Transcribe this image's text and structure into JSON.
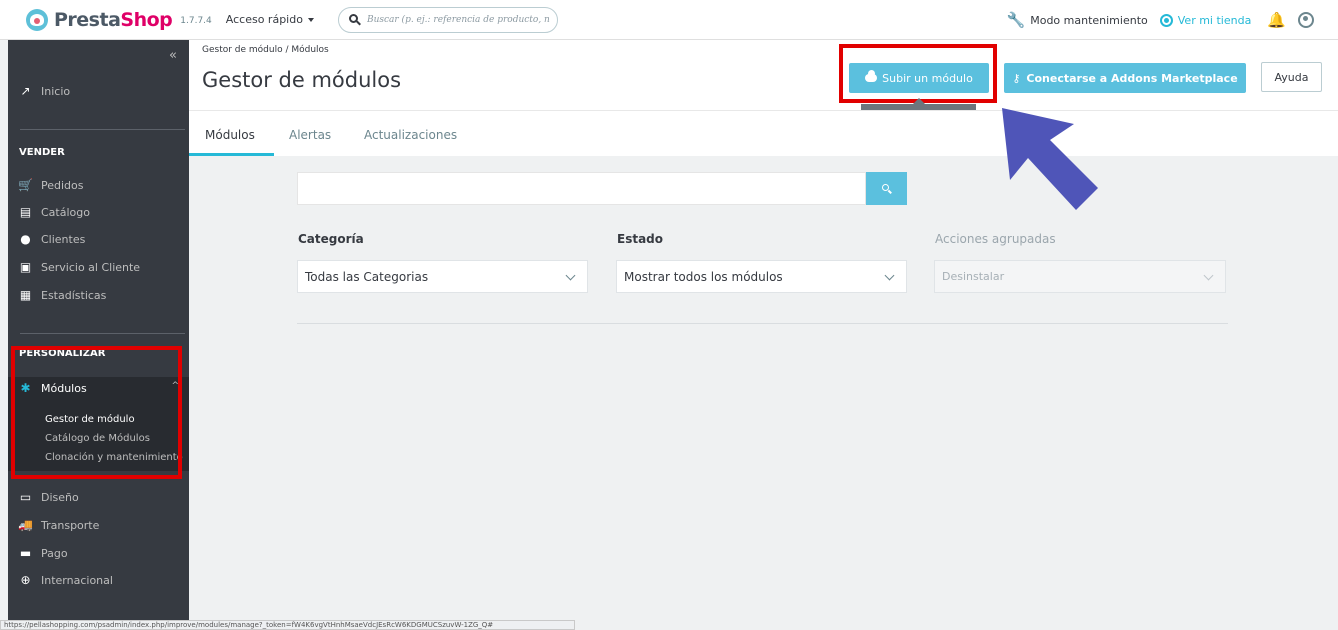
{
  "header": {
    "logo_text_presta": "Presta",
    "logo_text_shop": "Shop",
    "version": "1.7.7.4",
    "quick_access": "Acceso rápido",
    "search_placeholder": "Buscar (p. ej.: referencia de producto, n",
    "maintenance": "Modo mantenimiento",
    "view_store": "Ver mi tienda"
  },
  "sidebar": {
    "collapse": "«",
    "home": "Inicio",
    "sell_title": "VENDER",
    "sell_items": [
      "Pedidos",
      "Catálogo",
      "Clientes",
      "Servicio al Cliente",
      "Estadísticas"
    ],
    "customize_title": "PERSONALIZAR",
    "modules": "Módulos",
    "modules_sub": [
      "Gestor de módulo",
      "Catálogo de Módulos",
      "Clonación y mantenimiento"
    ],
    "other_items": [
      "Diseño",
      "Transporte",
      "Pago",
      "Internacional"
    ]
  },
  "page": {
    "breadcrumb": "Gestor de módulo  /  Módulos",
    "title": "Gestor de módulos",
    "upload_button": "Subir un módulo",
    "tooltip": "Subir un módulo",
    "addons_button": "Conectarse a Addons Marketplace",
    "help_button": "Ayuda",
    "tabs": [
      "Módulos",
      "Alertas",
      "Actualizaciones"
    ]
  },
  "filters": {
    "search_button_icon": "search-icon",
    "category_label": "Categoría",
    "category_value": "Todas las Categorias",
    "status_label": "Estado",
    "status_value": "Mostrar todos los módulos",
    "bulk_label": "Acciones agrupadas",
    "bulk_value": "Desinstalar"
  },
  "statusbar": "https://pellashopping.com/psadmin/index.php/improve/modules/manage?_token=fW4K6vgVtHnhMsaeVdcJEsRcW6KDGMUCSzuvW-1ZG_Q#",
  "colors": {
    "sidebar_bg": "#363a41",
    "accent": "#25b9d7",
    "button_blue": "#5bc0de",
    "highlight_red": "#e10000",
    "arrow": "#4f55b8"
  }
}
